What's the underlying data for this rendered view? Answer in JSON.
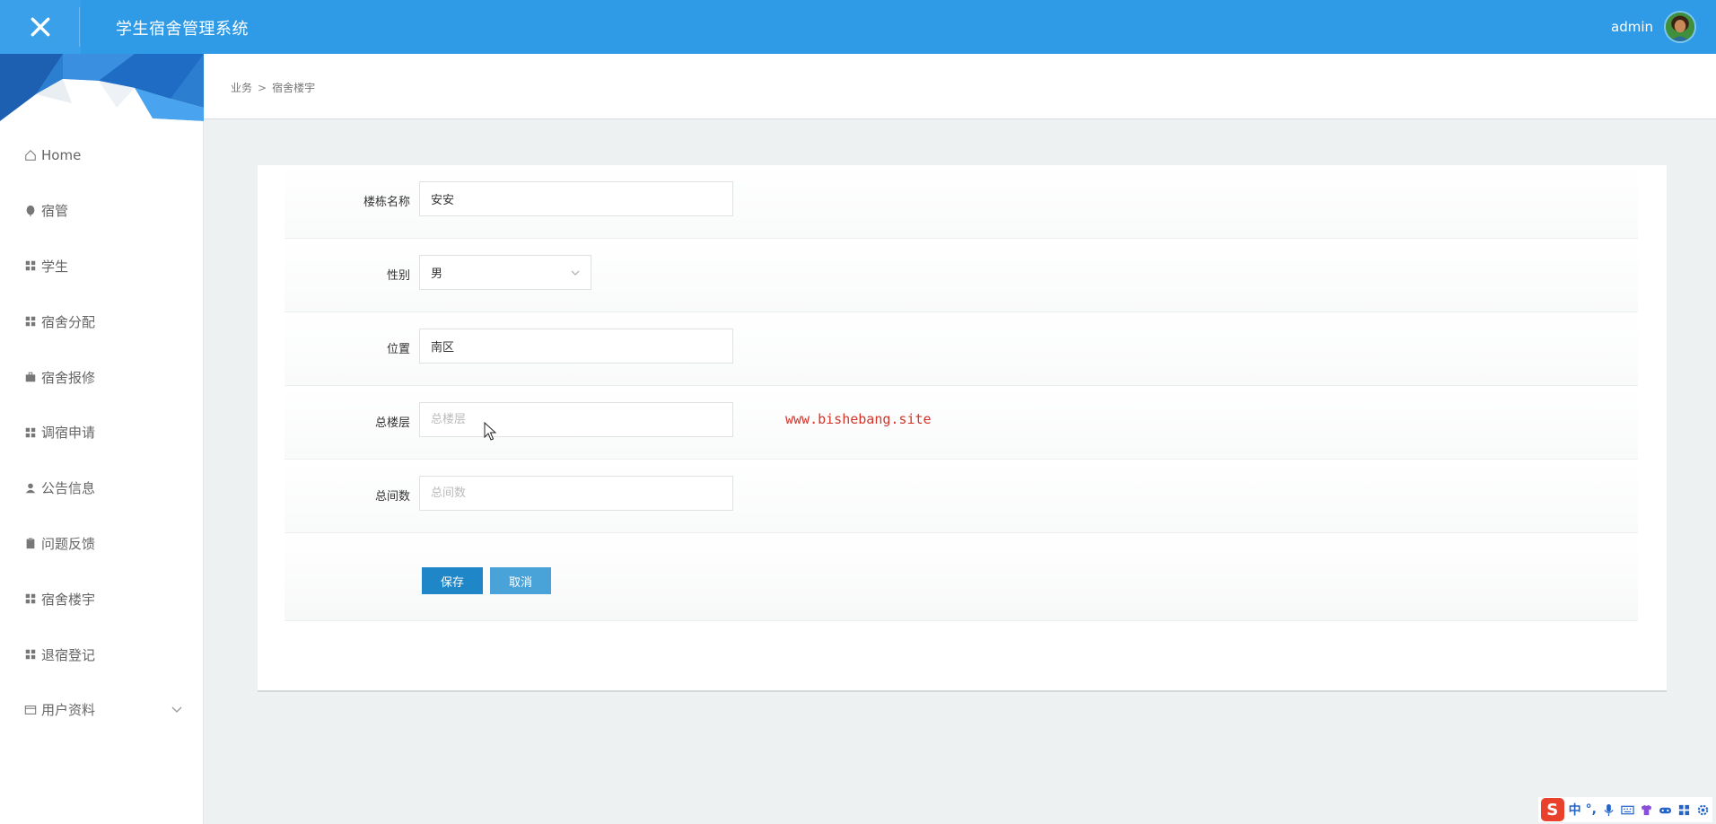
{
  "header": {
    "app_title": "学生宿舍管理系统",
    "username": "admin"
  },
  "sidebar": {
    "items": [
      {
        "label": "Home",
        "icon": "home-icon"
      },
      {
        "label": "宿管",
        "icon": "leaf-icon"
      },
      {
        "label": "学生",
        "icon": "grid-icon"
      },
      {
        "label": "宿舍分配",
        "icon": "grid-icon"
      },
      {
        "label": "宿舍报修",
        "icon": "briefcase-icon"
      },
      {
        "label": "调宿申请",
        "icon": "grid-icon"
      },
      {
        "label": "公告信息",
        "icon": "user-icon"
      },
      {
        "label": "问题反馈",
        "icon": "clipboard-icon"
      },
      {
        "label": "宿舍楼宇",
        "icon": "grid-icon"
      },
      {
        "label": "退宿登记",
        "icon": "grid-icon"
      },
      {
        "label": "用户资料",
        "icon": "card-icon"
      }
    ]
  },
  "breadcrumb": {
    "parent": "业务",
    "separator": ">",
    "current": "宿舍楼宇"
  },
  "form": {
    "building_name": {
      "label": "楼栋名称",
      "value": "安安",
      "placeholder": ""
    },
    "gender": {
      "label": "性别",
      "value": "男"
    },
    "location": {
      "label": "位置",
      "value": "南区",
      "placeholder": ""
    },
    "total_floors": {
      "label": "总楼层",
      "value": "",
      "placeholder": "总楼层"
    },
    "total_rooms": {
      "label": "总间数",
      "value": "",
      "placeholder": "总间数"
    },
    "save_label": "保存",
    "cancel_label": "取消"
  },
  "watermark": "www.bishebang.site",
  "tray": {
    "ime_logo": "S",
    "ime_mode": "中",
    "punct": "°,"
  },
  "colors": {
    "topbar": "#2f9ae6",
    "save_button": "#1f86c7",
    "cancel_button": "#4aa3d8",
    "watermark": "#d4342a"
  }
}
